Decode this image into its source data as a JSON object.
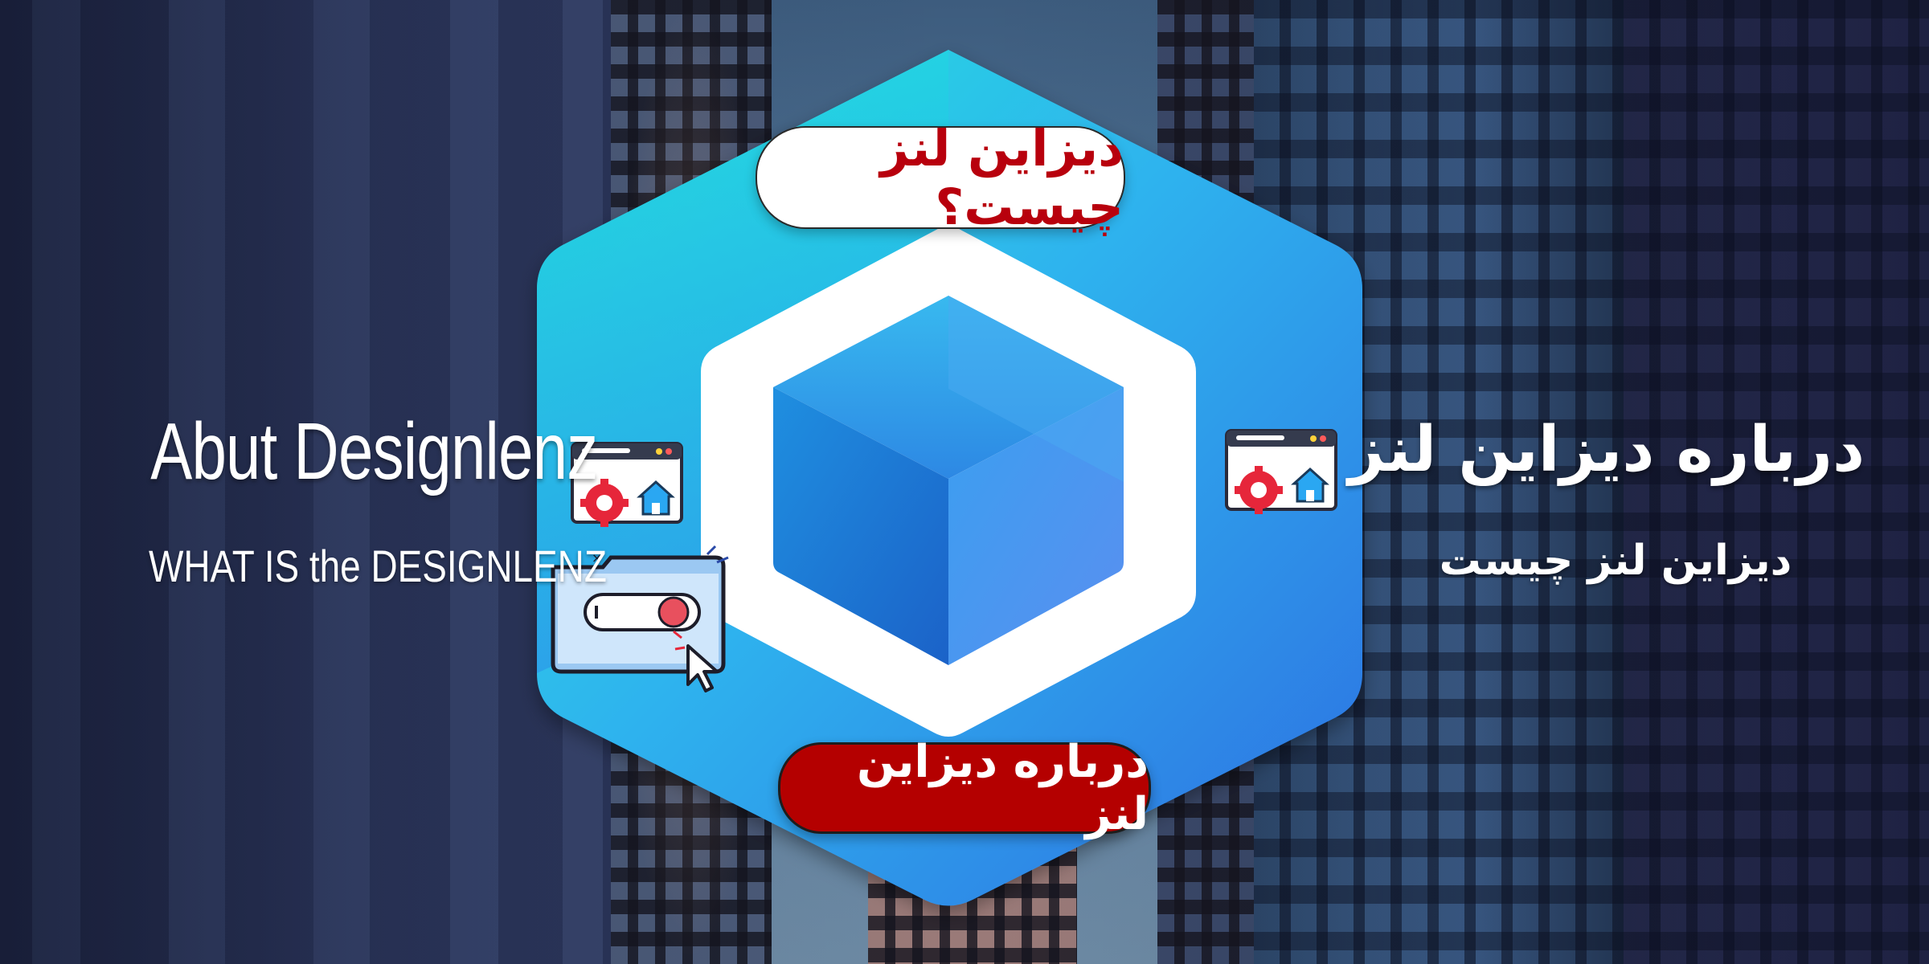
{
  "left_text": {
    "title": "Abut Designlenz",
    "subtitle": "WHAT IS the DESIGNLENZ"
  },
  "right_text": {
    "title": "درباره دیزاین لنز",
    "subtitle": "دیزاین لنز  چیست"
  },
  "badges": {
    "top": "دیزاین لنز چیست؟",
    "bottom": "درباره دیزاین  لنز"
  },
  "icons": {
    "left_window": "browser-settings-home-icon",
    "right_window": "browser-settings-home-icon",
    "toggle_card": "toggle-window-cursor-icon",
    "center_logo": "hexagon-cube-logo-icon"
  },
  "colors": {
    "accent_red": "#b40000",
    "hex_cyan": "#23e0df",
    "hex_blue": "#2f7fe6",
    "gear_red": "#e6263a",
    "home_blue": "#2aa7f2"
  }
}
